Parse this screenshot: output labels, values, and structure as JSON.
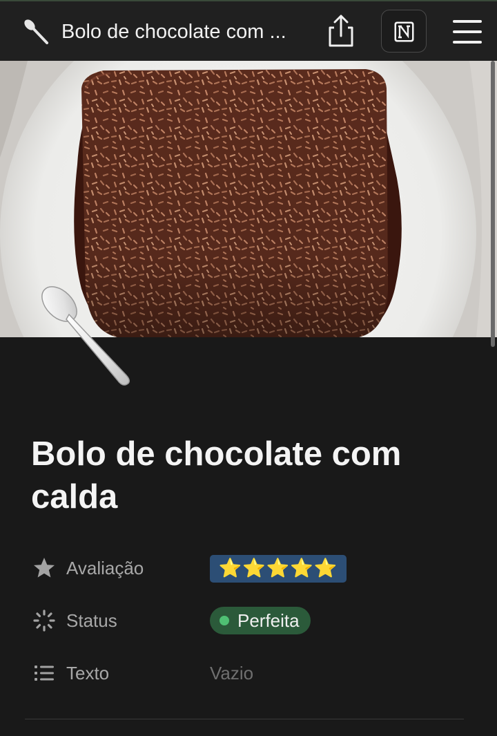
{
  "header": {
    "title": "Bolo de chocolate com ...",
    "page_icon": "spoon-icon",
    "share_icon": "share-icon",
    "notion_icon": "notion-logo-icon",
    "menu_icon": "hamburger-menu-icon"
  },
  "cover": {
    "subject": "chocolate cake with sprinkles on white plate"
  },
  "page": {
    "icon": "spoon-icon",
    "title": "Bolo de chocolate com calda"
  },
  "properties": [
    {
      "icon": "star-icon",
      "label": "Avaliação",
      "value": "⭐⭐⭐⭐⭐",
      "type": "rating",
      "color": "#2c4e75"
    },
    {
      "icon": "status-icon",
      "label": "Status",
      "value": "Perfeita",
      "type": "status",
      "color": "#2b5a3a",
      "dot_color": "#4fbf73"
    },
    {
      "icon": "list-icon",
      "label": "Texto",
      "value": "Vazio",
      "type": "empty"
    }
  ],
  "colors": {
    "background": "#191919",
    "topbar": "#202020",
    "text": "#f4f4f4",
    "muted": "#a8a8a8"
  }
}
